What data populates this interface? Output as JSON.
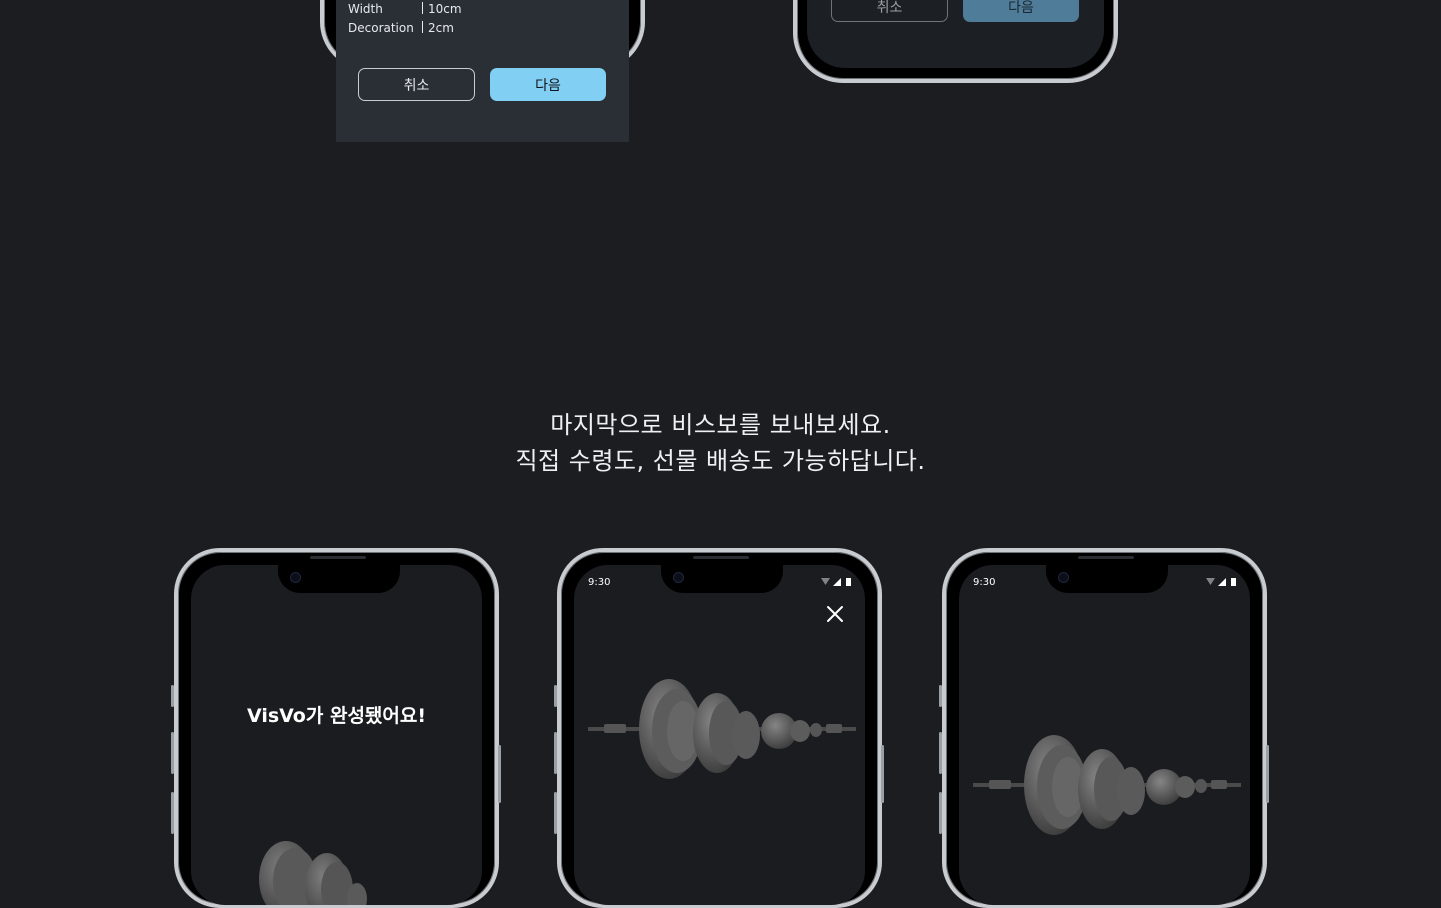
{
  "spec_panel": {
    "rows": [
      {
        "label": "Width",
        "value": "10cm"
      },
      {
        "label": "Decoration",
        "value": "2cm"
      }
    ],
    "cancel_label": "취소",
    "next_label": "다음"
  },
  "top_right_phone": {
    "cancel_label": "취소",
    "next_label": "다음"
  },
  "headline": {
    "line1": "마지막으로 비스보를 보내보세요.",
    "line2": "직접 수령도, 선물 배송도 가능하답니다."
  },
  "phone1": {
    "complete_text": "VisVo가 완성됐어요!"
  },
  "phone2": {
    "status_time": "9:30",
    "close_icon": "close-icon"
  },
  "phone3": {
    "status_time": "9:30"
  },
  "colors": {
    "background": "#1b1d20",
    "accent": "#82cff4",
    "panel": "#2a2f36"
  }
}
